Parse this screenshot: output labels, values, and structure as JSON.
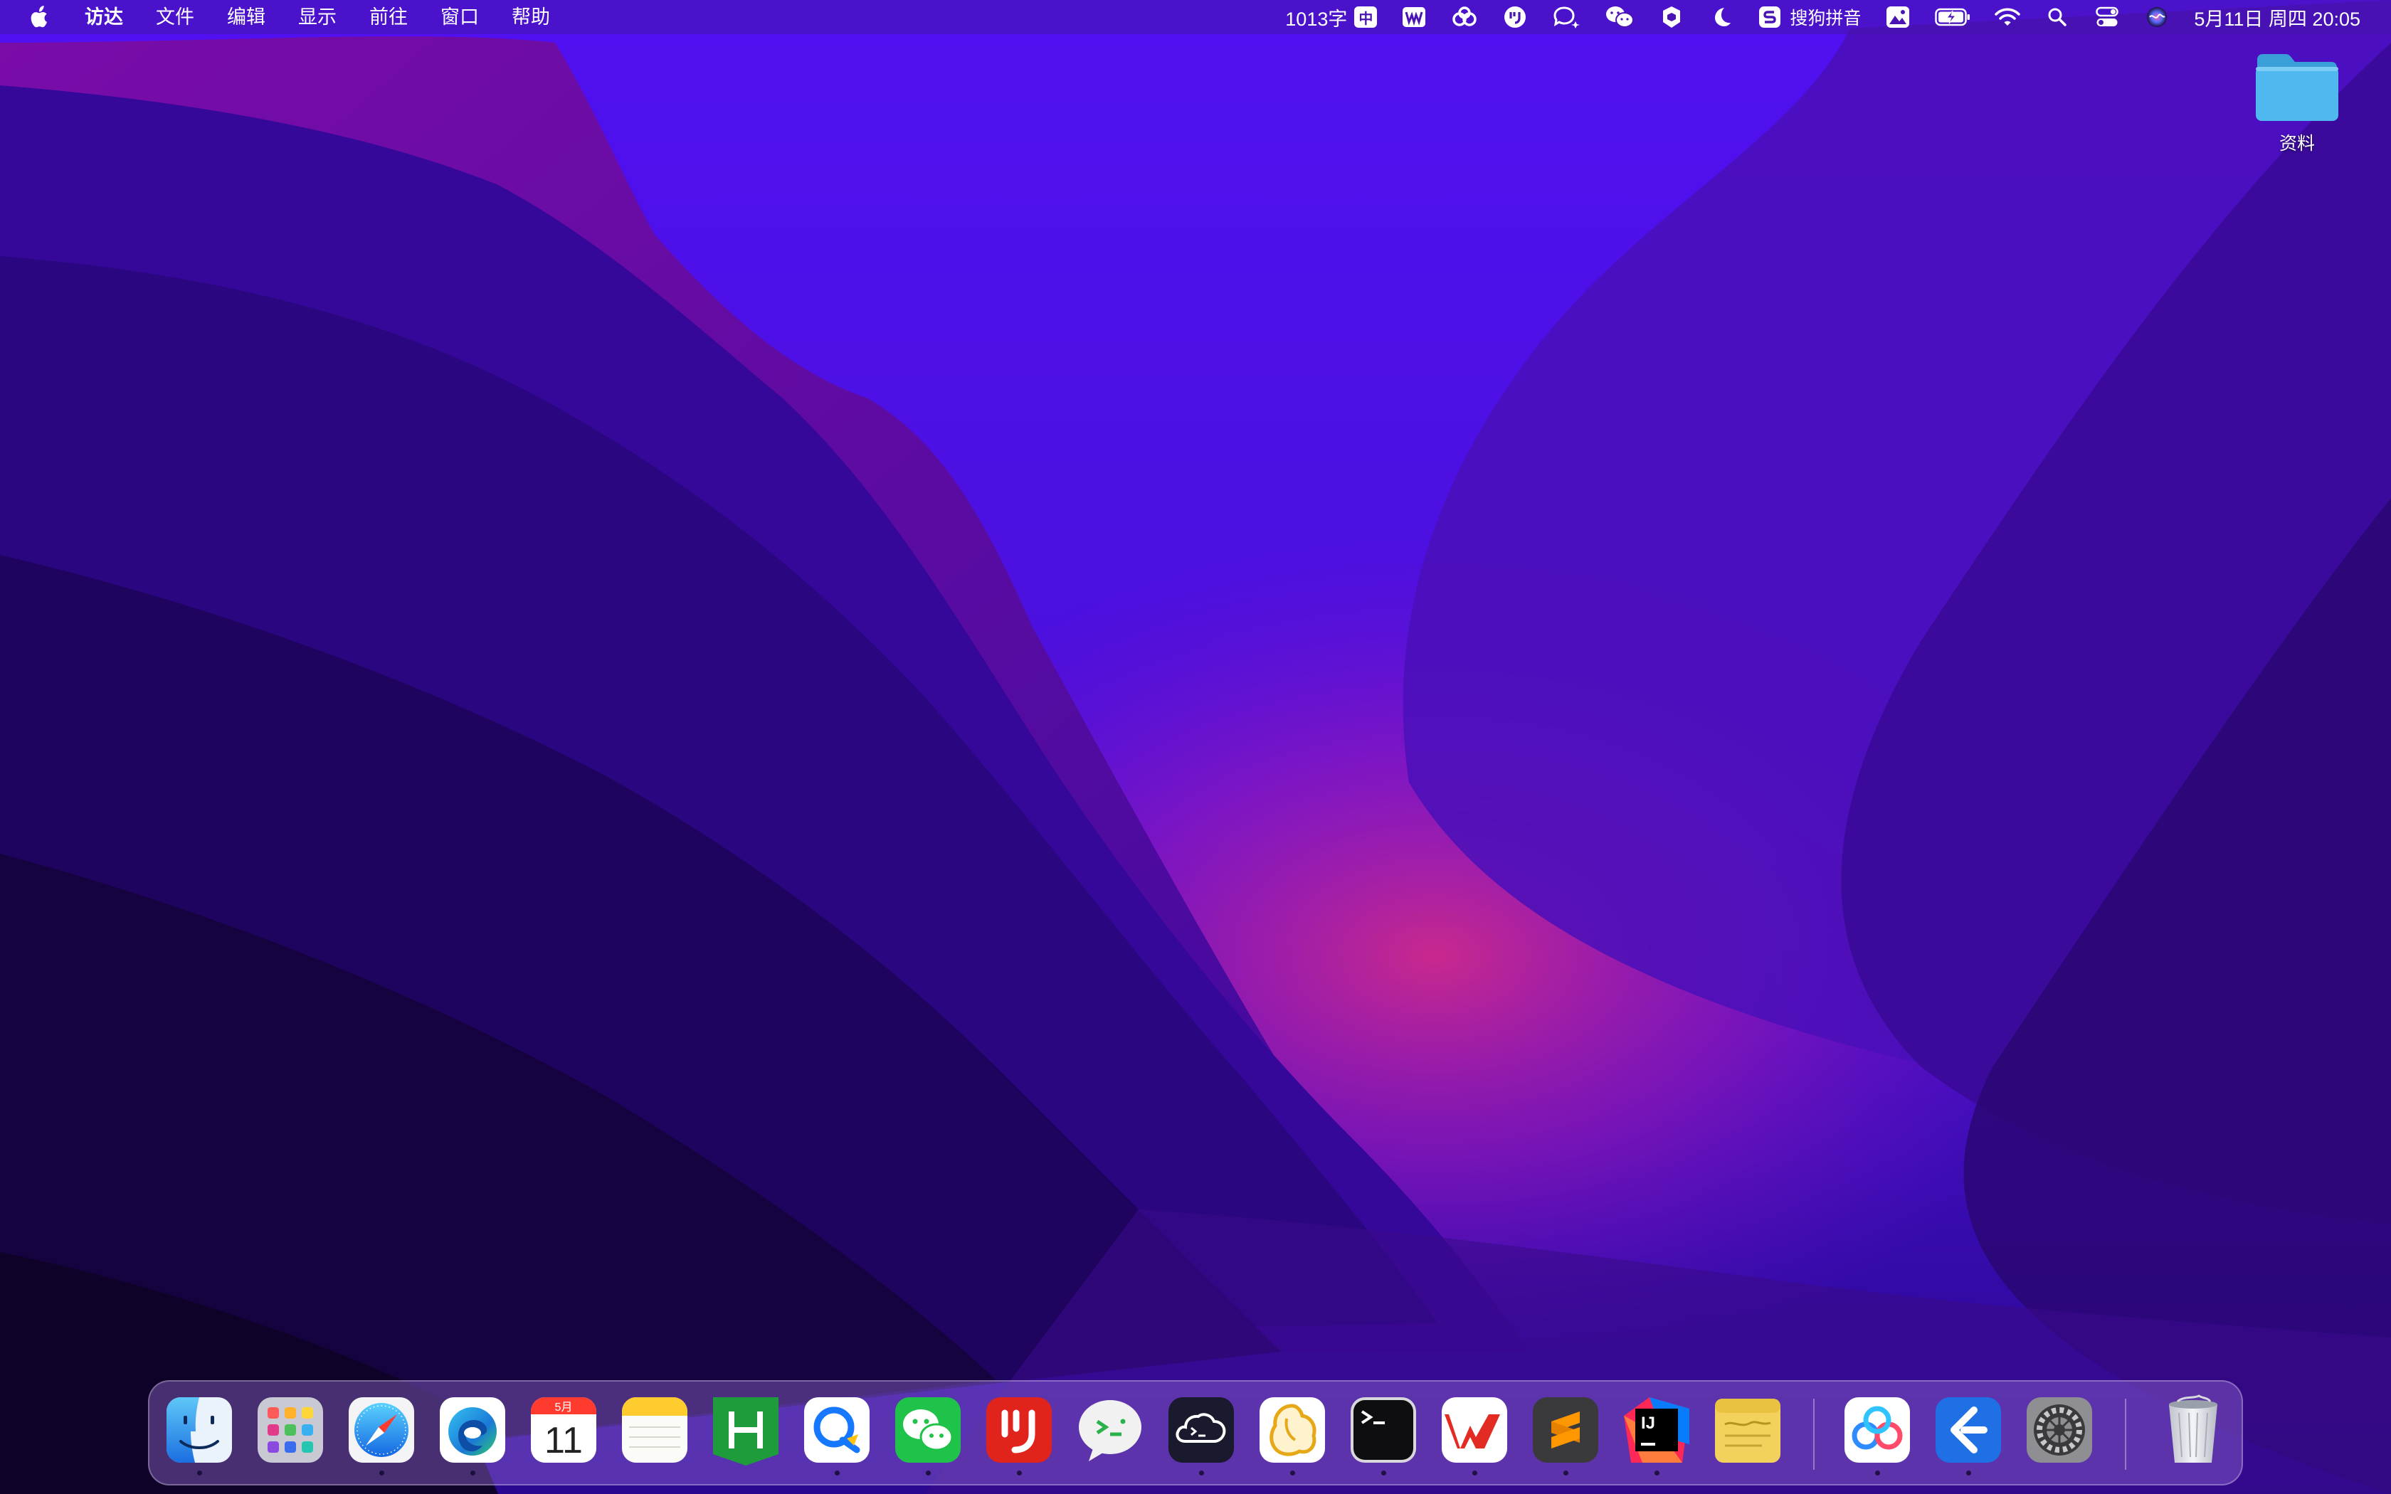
{
  "menubar": {
    "app_name": "访达",
    "menus": [
      "文件",
      "编辑",
      "显示",
      "前往",
      "窗口",
      "帮助"
    ],
    "word_count": "1013字",
    "input_mode": "中",
    "input_method": "搜狗拼音",
    "datetime": "5月11日 周四  20:05"
  },
  "desktop": {
    "folder_label": "资料"
  },
  "dock": {
    "calendar_month": "5月",
    "calendar_day": "11",
    "apps": [
      "finder",
      "launchpad",
      "safari",
      "edge",
      "calendar",
      "notes",
      "hbuilder",
      "lark",
      "wechat",
      "pinduoduo",
      "chat-bubble",
      "cloud-terminal",
      "navicat",
      "terminal",
      "wps",
      "sublime-text",
      "intellij-idea",
      "stickies",
      "baidu-netdisk",
      "remote-desktop",
      "system-settings",
      "trash"
    ]
  },
  "colors": {
    "wallpaper_top": "#5a12f0",
    "wallpaper_dark": "#12052e",
    "wallpaper_glow": "#c02090",
    "folder_blue": "#4fb8ee"
  }
}
